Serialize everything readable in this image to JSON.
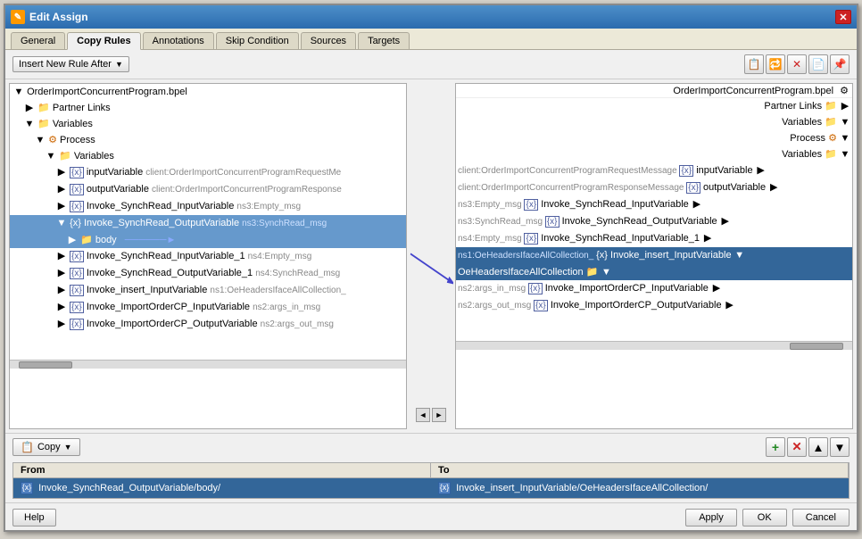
{
  "window": {
    "title": "Edit Assign",
    "icon": "✎",
    "close": "✕"
  },
  "tabs": [
    {
      "label": "General",
      "active": false
    },
    {
      "label": "Copy Rules",
      "active": true
    },
    {
      "label": "Annotations",
      "active": false
    },
    {
      "label": "Skip Condition",
      "active": false
    },
    {
      "label": "Sources",
      "active": false
    },
    {
      "label": "Targets",
      "active": false
    }
  ],
  "toolbar": {
    "insert_btn": "Insert New Rule After",
    "toolbar_icons": [
      "📋",
      "🔁",
      "✕",
      "📄",
      "📌"
    ]
  },
  "left_tree": {
    "root": "OrderImportConcurrentProgram.bpel",
    "items": [
      {
        "label": "Partner Links",
        "type": "folder",
        "indent": 1
      },
      {
        "label": "Variables",
        "type": "folder",
        "indent": 1
      },
      {
        "label": "Process",
        "type": "process",
        "indent": 2
      },
      {
        "label": "Variables",
        "type": "folder",
        "indent": 3
      },
      {
        "label": "inputVariable",
        "suffix": "client:OrderImportConcurrentProgramRequestMe",
        "type": "var",
        "indent": 4
      },
      {
        "label": "outputVariable",
        "suffix": "client:OrderImportConcurrentProgramResponse",
        "type": "var",
        "indent": 4
      },
      {
        "label": "Invoke_SynchRead_InputVariable",
        "suffix": "ns3:Empty_msg",
        "type": "var",
        "indent": 4
      },
      {
        "label": "Invoke_SynchRead_OutputVariable",
        "suffix": "ns3:SynchRead_msg",
        "type": "var",
        "indent": 4,
        "selected": true
      },
      {
        "label": "body",
        "type": "body",
        "indent": 5,
        "selected": true
      },
      {
        "label": "Invoke_SynchRead_InputVariable_1",
        "suffix": "ns4:Empty_msg",
        "type": "var",
        "indent": 4
      },
      {
        "label": "Invoke_SynchRead_OutputVariable_1",
        "suffix": "ns4:SynchRead_msg",
        "type": "var",
        "indent": 4
      },
      {
        "label": "Invoke_insert_InputVariable",
        "suffix": "ns1:OeHeadersIfaceAllCollection_",
        "type": "var",
        "indent": 4
      },
      {
        "label": "Invoke_ImportOrderCP_InputVariable",
        "suffix": "ns2:args_in_msg",
        "type": "var",
        "indent": 4
      },
      {
        "label": "Invoke_ImportOrderCP_OutputVariable",
        "suffix": "ns2:args_out_msg",
        "type": "var",
        "indent": 4
      }
    ]
  },
  "right_tree": {
    "root": "OrderImportConcurrentProgram.bpel",
    "items": [
      {
        "label": "Partner Links",
        "type": "folder",
        "indent": 1
      },
      {
        "label": "Variables",
        "type": "folder",
        "indent": 1
      },
      {
        "label": "Process",
        "type": "process",
        "indent": 2
      },
      {
        "label": "Variables",
        "type": "folder",
        "indent": 3
      },
      {
        "label": "inputVariable",
        "suffix": "client:OrderImportConcurrentProgramRequestMessage",
        "type": "var",
        "indent": 4
      },
      {
        "label": "outputVariable",
        "suffix": "client:OrderImportConcurrentProgramResponseMessage",
        "type": "var",
        "indent": 4
      },
      {
        "label": "Invoke_SynchRead_InputVariable",
        "suffix": "ns3:Empty_msg",
        "type": "var",
        "indent": 4
      },
      {
        "label": "Invoke_SynchRead_OutputVariable",
        "suffix": "ns3:SynchRead_msg",
        "type": "var",
        "indent": 4
      },
      {
        "label": "Invoke_SynchRead_InputVariable_1",
        "suffix": "ns4:Empty_msg",
        "type": "var",
        "indent": 4
      },
      {
        "label": "Invoke_insert_InputVariable",
        "suffix": "ns1:OeHeadersIfaceAllCollection_",
        "type": "var",
        "indent": 4,
        "selected": true
      },
      {
        "label": "OeHeadersIfaceAllCollection",
        "type": "body",
        "indent": 5,
        "selected": true
      },
      {
        "label": "Invoke_ImportOrderCP_InputVariable",
        "suffix": "ns2:args_in_msg",
        "type": "var",
        "indent": 4
      },
      {
        "label": "Invoke_ImportOrderCP_OutputVariable",
        "suffix": "ns2:args_out_msg",
        "type": "var",
        "indent": 4
      }
    ]
  },
  "copy_section": {
    "copy_btn": "Copy",
    "copy_icon": "📋",
    "action_icons": [
      "+",
      "✕",
      "▲",
      "▼"
    ],
    "table": {
      "headers": [
        "From",
        "To"
      ],
      "rows": [
        {
          "from": "Invoke_SynchRead_OutputVariable/body/",
          "to": "Invoke_insert_InputVariable/OeHeadersIfaceAllCollection/"
        }
      ]
    }
  },
  "footer": {
    "help": "Help",
    "apply": "Apply",
    "ok": "OK",
    "cancel": "Cancel"
  }
}
